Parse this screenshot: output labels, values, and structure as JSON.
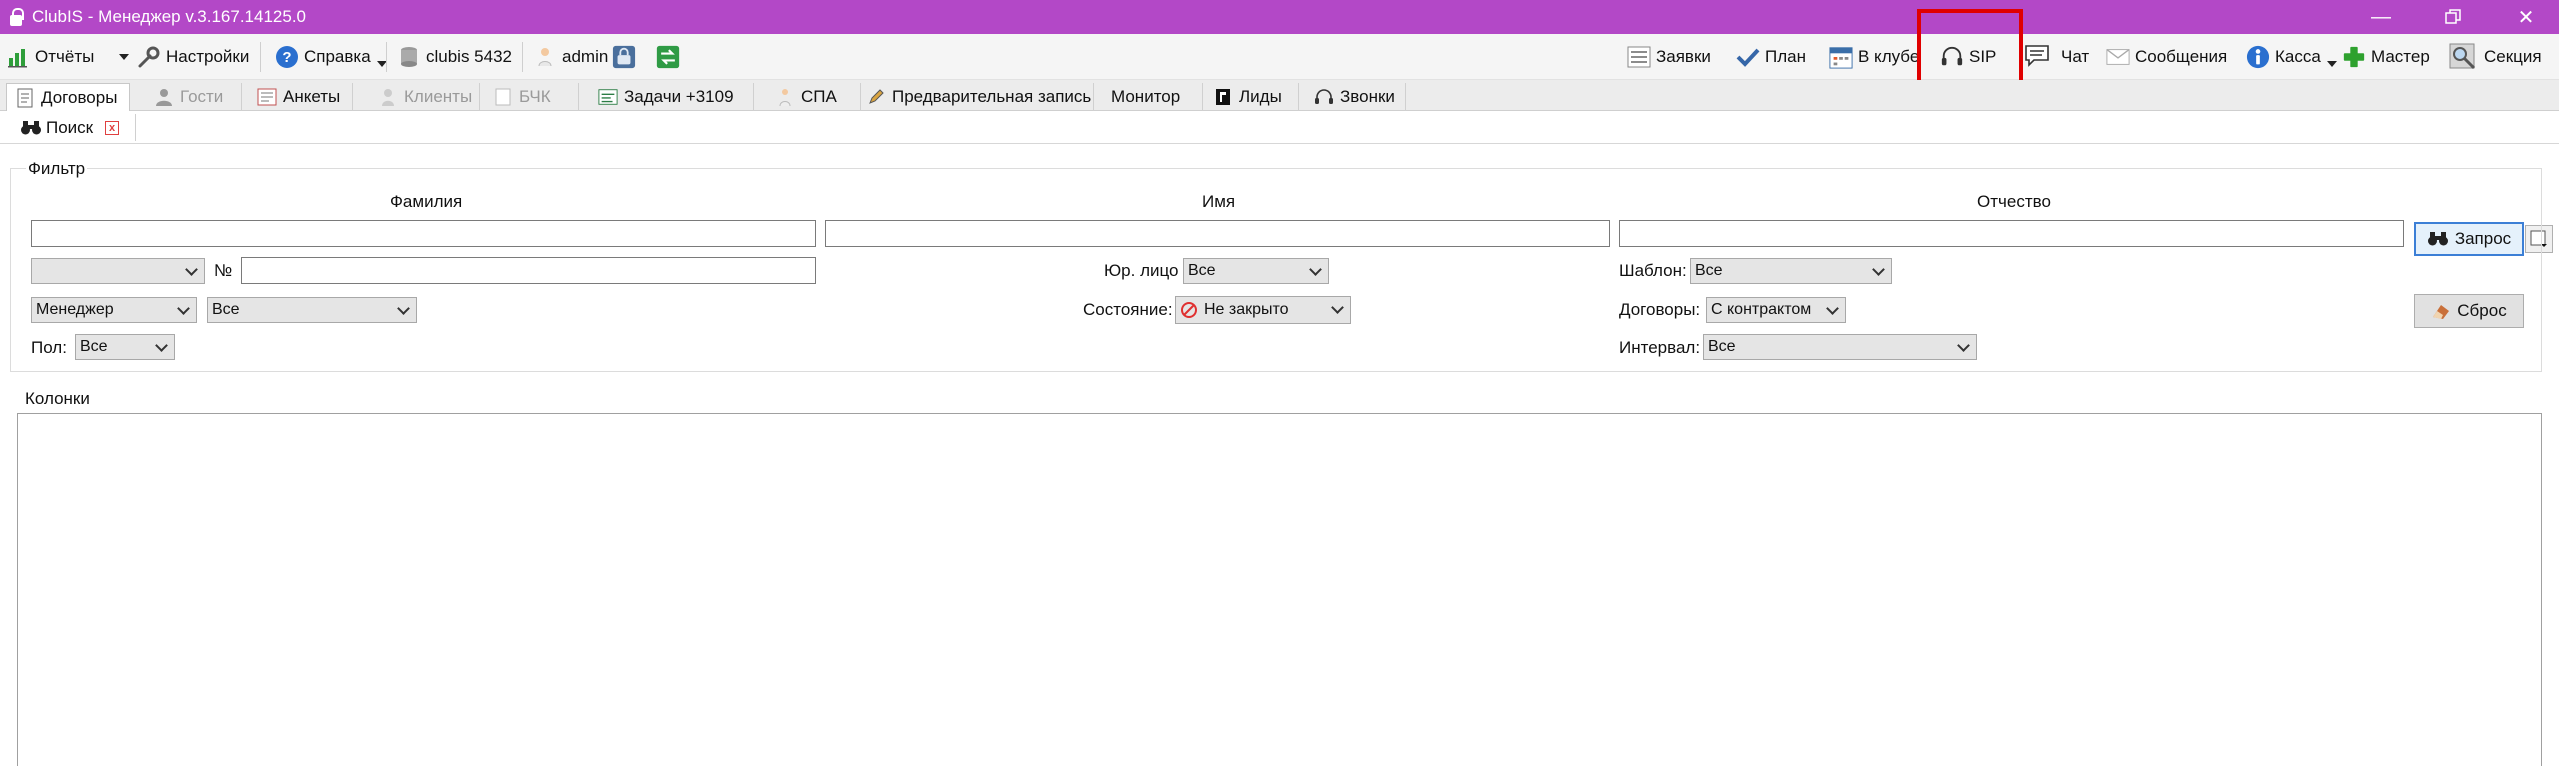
{
  "window": {
    "title": "ClubIS - Менеджер v.3.167.14125.0",
    "controls": [
      "minimize-icon",
      "restore-icon",
      "close-icon"
    ]
  },
  "toolbar": {
    "reports": "Отчёты",
    "settings": "Настройки",
    "help": "Справка",
    "db": "clubis 5432",
    "user": "admin",
    "requests": "Заявки",
    "plan": "План",
    "in_club": "В клубе",
    "sip": "SIP",
    "chat": "Чат",
    "messages": "Сообщения",
    "cashbox": "Касса",
    "wizard": "Мастер",
    "section": "Секция"
  },
  "tabs": [
    {
      "label": "Договоры",
      "icon": "document-icon",
      "active": true,
      "enabled": true
    },
    {
      "label": "Гости",
      "icon": "person-icon",
      "active": false,
      "enabled": false
    },
    {
      "label": "Анкеты",
      "icon": "form-icon",
      "active": false,
      "enabled": true
    },
    {
      "label": "Клиенты",
      "icon": "clients-icon",
      "active": false,
      "enabled": false
    },
    {
      "label": "БЧК",
      "icon": "card-icon",
      "active": false,
      "enabled": false
    },
    {
      "label": "Задачи +3109",
      "icon": "tasks-icon",
      "active": false,
      "enabled": true
    },
    {
      "label": "СПА",
      "icon": "spa-icon",
      "active": false,
      "enabled": true
    },
    {
      "label": "Предварительная запись",
      "icon": "pencil-icon",
      "active": false,
      "enabled": true
    },
    {
      "label": "Монитор",
      "icon": "",
      "active": false,
      "enabled": true
    },
    {
      "label": "Лиды",
      "icon": "leads-icon",
      "active": false,
      "enabled": true
    },
    {
      "label": "Звонки",
      "icon": "headset-icon",
      "active": false,
      "enabled": true
    }
  ],
  "subtab": {
    "label": "Поиск",
    "icon": "binoculars-icon"
  },
  "filter": {
    "legend": "Фильтр",
    "lastname_label": "Фамилия",
    "firstname_label": "Имя",
    "patronymic_label": "Отчество",
    "lastname_value": "",
    "firstname_value": "",
    "patronymic_value": "",
    "number_label": "№",
    "number_value": "",
    "doc_type_select": "",
    "legal_label": "Юр. лицо",
    "legal_value": "Все",
    "template_label": "Шаблон:",
    "template_value": "Все",
    "manager_select": "Менеджер",
    "manager_value": "Все",
    "state_label": "Состояние:",
    "state_value": "Не закрыто",
    "contracts_label": "Договоры:",
    "contracts_value": "С контрактом",
    "gender_label": "Пол:",
    "gender_value": "Все",
    "interval_label": "Интервал:",
    "interval_value": "Все",
    "query_button": "Запрос",
    "reset_button": "Сброс"
  },
  "columns": {
    "label": "Колонки"
  },
  "colors": {
    "titlebar": "#b348c7",
    "highlight": "#e00000",
    "primary_button_border": "#3c7fd6"
  }
}
